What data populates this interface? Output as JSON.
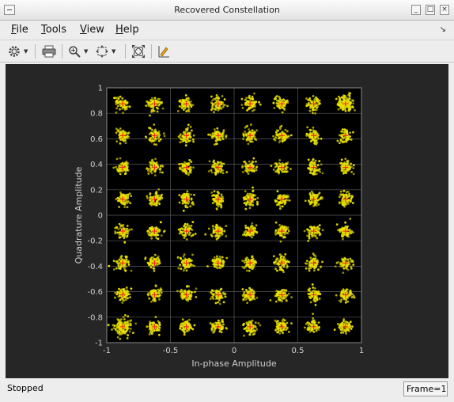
{
  "window": {
    "title": "Recovered Constellation"
  },
  "menu": {
    "items": [
      {
        "accel": "F",
        "rest": "ile"
      },
      {
        "accel": "T",
        "rest": "ools"
      },
      {
        "accel": "V",
        "rest": "iew"
      },
      {
        "accel": "H",
        "rest": "elp"
      }
    ]
  },
  "toolbar": {
    "icons": [
      "gear-icon",
      "print-icon",
      "zoom-icon",
      "fit-to-view-icon",
      "autoscale-icon",
      "plot-style-icon"
    ]
  },
  "status": {
    "text": "Stopped",
    "frame": "Frame=1"
  },
  "colors": {
    "points": "#e8e200",
    "reference": "#ff1a1a",
    "axes_bg": "#000000",
    "figure_bg": "#262626",
    "grid": "#5a5a5a"
  },
  "chart_data": {
    "type": "scatter",
    "xlabel": "In-phase Amplitude",
    "ylabel": "Quadrature Amplitude",
    "xlim": [
      -1,
      1
    ],
    "ylim": [
      -1,
      1
    ],
    "xticks": [
      "-1",
      "-0.5",
      "0",
      "0.5",
      "1"
    ],
    "yticks": [
      "1",
      "0.8",
      "0.6",
      "0.4",
      "0.2",
      "0",
      "-0.2",
      "-0.4",
      "-0.6",
      "-0.8",
      "-1"
    ],
    "grid": true,
    "reference_levels": [
      -0.875,
      -0.625,
      -0.375,
      -0.125,
      0.125,
      0.375,
      0.625,
      0.875
    ],
    "series": [
      {
        "marker": "dot",
        "points_per_cluster": 70
      },
      {
        "marker": "plus",
        "points_per_cluster": 1
      }
    ]
  }
}
